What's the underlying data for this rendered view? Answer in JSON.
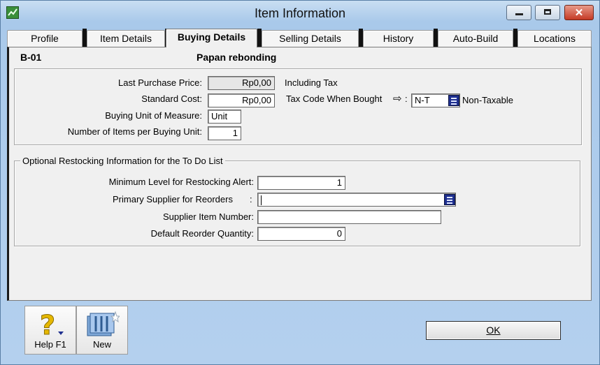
{
  "window": {
    "title": "Item Information"
  },
  "tabs": [
    {
      "label": "Profile"
    },
    {
      "label": "Item Details"
    },
    {
      "label": "Buying Details"
    },
    {
      "label": "Selling Details"
    },
    {
      "label": "History"
    },
    {
      "label": "Auto-Build"
    },
    {
      "label": "Locations"
    }
  ],
  "active_tab": "Buying Details",
  "item": {
    "number": "B-01",
    "name": "Papan rebonding"
  },
  "buying": {
    "last_purchase_price_label": "Last Purchase Price:",
    "last_purchase_price": "Rp0,00",
    "including_tax": "Including Tax",
    "standard_cost_label": "Standard Cost:",
    "standard_cost": "Rp0,00",
    "tax_code_label": "Tax Code When Bought",
    "tax_code_colon": ":",
    "tax_code": "N-T",
    "tax_code_desc": "Non-Taxable",
    "unit_label": "Buying Unit of Measure:",
    "unit": "Unit",
    "items_per_unit_label": "Number of Items per Buying Unit:",
    "items_per_unit": "1"
  },
  "restock": {
    "legend": "Optional Restocking Information for the To Do List",
    "min_level_label": "Minimum Level for Restocking Alert:",
    "min_level": "1",
    "supplier_label": "Primary Supplier for Reorders",
    "supplier_colon": ":",
    "supplier": "",
    "supplier_item_label": "Supplier Item Number:",
    "supplier_item": "",
    "reorder_qty_label": "Default Reorder Quantity:",
    "reorder_qty": "0"
  },
  "buttons": {
    "help": "Help F1",
    "new": "New",
    "ok": "OK"
  }
}
